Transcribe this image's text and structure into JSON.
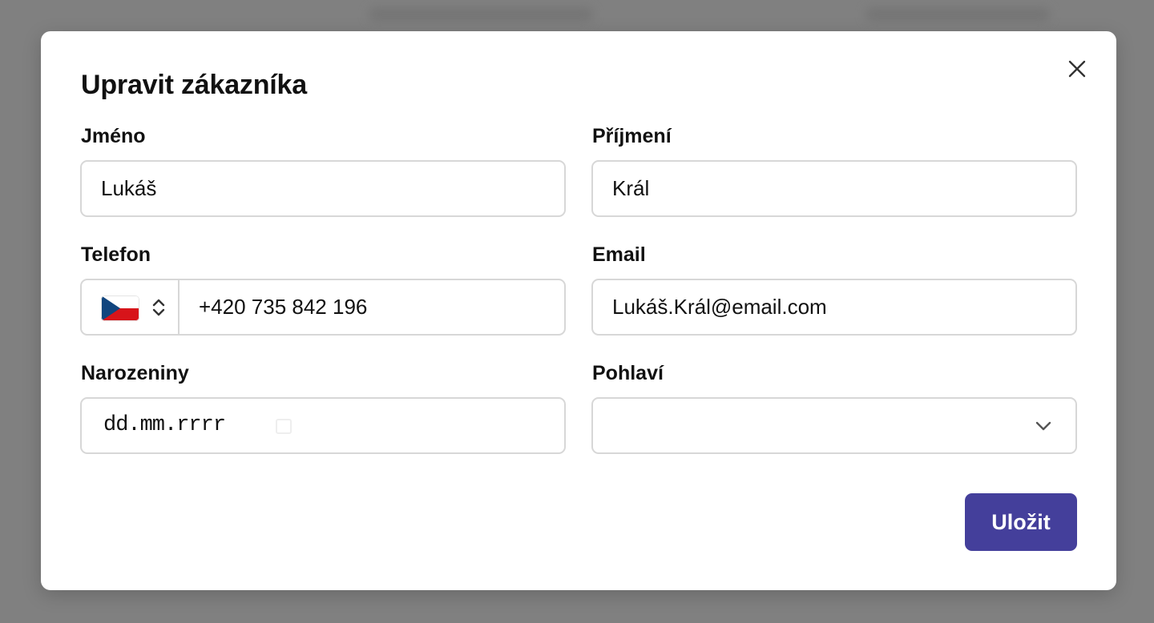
{
  "modal": {
    "title": "Upravit zákazníka",
    "close_icon": "close-icon"
  },
  "fields": {
    "first_name": {
      "label": "Jméno",
      "value": "Lukáš"
    },
    "last_name": {
      "label": "Příjmení",
      "value": "Král"
    },
    "phone": {
      "label": "Telefon",
      "country_flag_icon": "czech-flag-icon",
      "country_toggle_icon": "chevron-up-down-icon",
      "value": "+420 735 842 196"
    },
    "email": {
      "label": "Email",
      "value": "Lukáš.Král@email.com"
    },
    "birthday": {
      "label": "Narozeniny",
      "placeholder": "dd.mm.rrrr",
      "icon": "calendar-icon"
    },
    "gender": {
      "label": "Pohlaví",
      "value": "",
      "icon": "chevron-down-icon"
    }
  },
  "actions": {
    "save_label": "Uložit"
  },
  "colors": {
    "primary": "#443f9b",
    "border": "#d7d7d7",
    "overlay": "#808080",
    "flag_white": "#ffffff",
    "flag_red": "#d7141a",
    "flag_blue": "#11457e"
  }
}
